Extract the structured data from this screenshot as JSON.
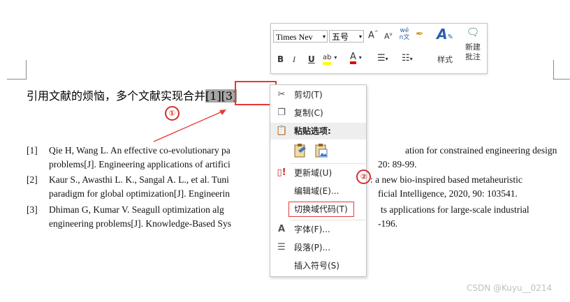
{
  "document": {
    "text_before": "引用文献的烦恼，多个文献实现合并",
    "selected_citation": "[1][3]",
    "references": [
      {
        "num": "[1]",
        "line1": "Qie H, Wang L. An effective co-evolutionary pa",
        "line1_tail": "ation for constrained engineering design",
        "line2": "problems[J]. Engineering applications of artifici",
        "line2_tail": "20: 89-99."
      },
      {
        "num": "[2]",
        "line1": "Kaur S., Awasthi L. K., Sangal A. L., et al. Tuni",
        "line1_tail": ": a new bio-inspired based metaheuristic",
        "line2": "paradigm for global optimization[J]. Engineerin",
        "line2_tail": "ficial Intelligence, 2020, 90: 103541."
      },
      {
        "num": "[3]",
        "line1": "Dhiman G, Kumar V. Seagull optimization alg",
        "line1_tail": "ts applications for large-scale industrial",
        "line2": "engineering problems[J]. Knowledge-Based Sys",
        "line2_tail": "-196."
      }
    ]
  },
  "annotations": {
    "step1": "①",
    "step2": "②",
    "color": "#e53935"
  },
  "mini_toolbar": {
    "font_name": "Times Ne​v",
    "font_size": "五号",
    "grow_font": "A",
    "shrink_font": "A",
    "phonetic": "wén文",
    "bold": "B",
    "italic": "I",
    "underline": "U",
    "highlight": "ab",
    "font_color": "A",
    "styles_label": "样式",
    "new_comment_line1": "新建",
    "new_comment_line2": "批注"
  },
  "context_menu": {
    "items": [
      {
        "label": "剪切(T)",
        "icon": "scissors-icon"
      },
      {
        "label": "复制(C)",
        "icon": "copy-icon"
      },
      {
        "label": "粘贴选项:",
        "icon": "paste-icon",
        "header": true
      },
      {
        "label": "更新域(U)",
        "icon": "update-field-icon"
      },
      {
        "label": "编辑域(E)...",
        "icon": ""
      },
      {
        "label": "切换域代码(T)",
        "icon": "",
        "highlighted": true
      },
      {
        "label": "字体(F)...",
        "icon": "font-icon"
      },
      {
        "label": "段落(P)...",
        "icon": "paragraph-icon"
      },
      {
        "label": "插入符号(S)",
        "icon": ""
      }
    ]
  },
  "watermark": "CSDN @Kuyu__0214"
}
